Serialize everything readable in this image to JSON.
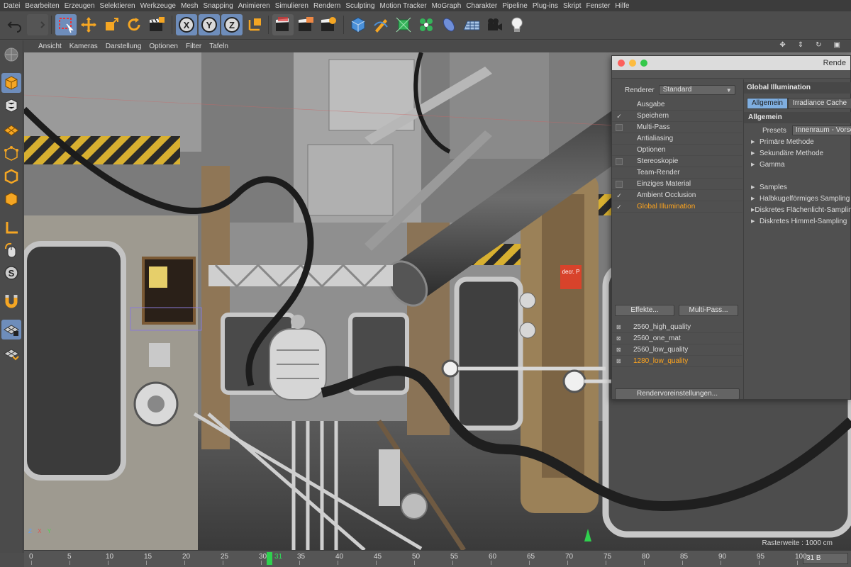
{
  "menu": [
    "Datei",
    "Bearbeiten",
    "Erzeugen",
    "Selektieren",
    "Werkzeuge",
    "Mesh",
    "Snapping",
    "Animieren",
    "Simulieren",
    "Rendern",
    "Sculpting",
    "Motion Tracker",
    "MoGraph",
    "Charakter",
    "Pipeline",
    "Plug-ins",
    "Skript",
    "Fenster",
    "Hilfe"
  ],
  "toolbar": {
    "icons": [
      "undo-icon",
      "redo-icon",
      "select-icon",
      "move-icon",
      "scale-icon",
      "rotate-icon",
      "clapboard-icon",
      "x-axis-icon",
      "y-axis-icon",
      "z-axis-icon",
      "world-coords-icon",
      "render-view-icon",
      "render-picture-viewer-icon",
      "render-settings-icon",
      "cube-icon",
      "pen-icon",
      "subdivision-icon",
      "cloner-icon",
      "deformer-icon",
      "floor-icon",
      "camera-icon",
      "light-icon"
    ],
    "axis_x": "X",
    "axis_y": "Y",
    "axis_z": "Z"
  },
  "viewport_menu": [
    "Ansicht",
    "Kameras",
    "Darstellung",
    "Optionen",
    "Filter",
    "Tafeln"
  ],
  "viewport": {
    "raster": "Rasterweite : 1000 cm",
    "axis_x": "X",
    "axis_y": "Y",
    "axis_z": "Z",
    "sign_text": "decr. P"
  },
  "render_window": {
    "title": "Rende",
    "renderer_label": "Renderer",
    "renderer_value": "Standard",
    "items": [
      {
        "label": "Ausgabe",
        "checked": false,
        "checkbox": false
      },
      {
        "label": "Speichern",
        "checked": true,
        "checkbox": true
      },
      {
        "label": "Multi-Pass",
        "checked": false,
        "checkbox": true
      },
      {
        "label": "Antialiasing",
        "checked": false,
        "checkbox": false
      },
      {
        "label": "Optionen",
        "checked": false,
        "checkbox": false
      },
      {
        "label": "Stereoskopie",
        "checked": false,
        "checkbox": true
      },
      {
        "label": "Team-Render",
        "checked": false,
        "checkbox": false
      },
      {
        "label": "Einziges Material",
        "checked": false,
        "checkbox": true
      },
      {
        "label": "Ambient Occlusion",
        "checked": true,
        "checkbox": true
      },
      {
        "label": "Global Illumination",
        "checked": true,
        "checkbox": true,
        "active": true
      }
    ],
    "effects_button": "Effekte...",
    "multipass_button": "Multi-Pass...",
    "presets": [
      {
        "label": "2560_high_quality",
        "active": false
      },
      {
        "label": "2560_one_mat",
        "active": false
      },
      {
        "label": "2560_low_quality",
        "active": false
      },
      {
        "label": "1280_low_quality",
        "active": true
      }
    ],
    "presets_button": "Rendervoreinstellungen...",
    "gi": {
      "title": "Global Illumination",
      "tab_general": "Allgemein",
      "tab_irradiance": "Irradiance Cache",
      "section": "Allgemein",
      "presets_label": "Presets",
      "presets_value": "Innenraum - Vorschau",
      "rows": [
        "Primäre Methode",
        "Sekundäre Methode",
        "Gamma",
        "",
        "Samples",
        "Halbkugelförmiges Sampling",
        "Diskretes Flächenlicht-Sampling",
        "Diskretes Himmel-Sampling"
      ]
    }
  },
  "timeline": {
    "ticks": [
      "0",
      "5",
      "10",
      "15",
      "20",
      "25",
      "30",
      "35",
      "40",
      "45",
      "50",
      "55",
      "60",
      "65",
      "70",
      "75",
      "80",
      "85",
      "90",
      "95",
      "100"
    ],
    "current_frame": "31",
    "frame_field": "31 B"
  },
  "colors": {
    "accent_orange": "#ffa51e",
    "tab_blue": "#7faee0",
    "playhead_green": "#2fd14e",
    "ui_gray": "#4d4d4d"
  }
}
